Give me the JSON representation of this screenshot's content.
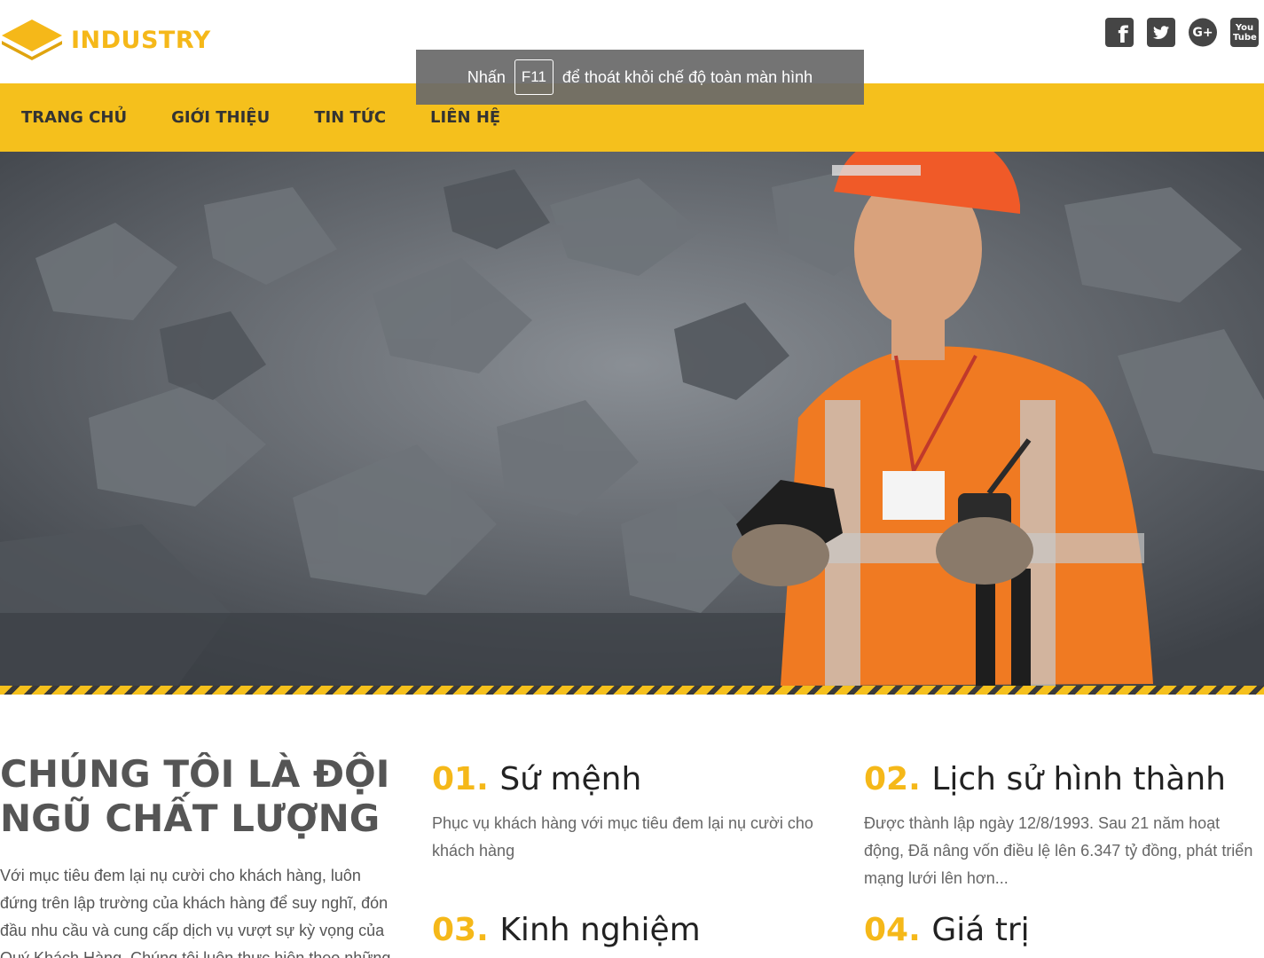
{
  "brand": {
    "name": "INDUSTRY",
    "accent": "#f5c01c"
  },
  "social": {
    "facebook_label": "f",
    "twitter_label": "t",
    "gplus_label": "G+",
    "youtube_label": "You Tube"
  },
  "nav": {
    "items": [
      {
        "label": "TRANG CHỦ"
      },
      {
        "label": "GIỚI THIỆU"
      },
      {
        "label": "TIN TỨC"
      },
      {
        "label": "LIÊN HỆ"
      }
    ]
  },
  "toast": {
    "prefix": "Nhấn",
    "key": "F11",
    "suffix": "để thoát khỏi chế độ toàn màn hình"
  },
  "intro": {
    "title": "CHÚNG TÔI LÀ ĐỘI NGŨ CHẤT LƯỢNG",
    "text": "Với mục tiêu đem lại nụ cười cho khách hàng, luôn đứng trên lập trường của khách hàng để suy nghĩ, đón đầu nhu cầu và cung cấp dịch vụ vượt sự kỳ vọng của Quý Khách Hàng. Chúng tôi luôn thực hiện theo những"
  },
  "features": [
    {
      "num": "01.",
      "title": "Sứ mệnh",
      "text": "Phục vụ khách hàng với mục tiêu đem lại nụ cười cho khách hàng"
    },
    {
      "num": "02.",
      "title": "Lịch sử hình thành",
      "text": "Được thành lập ngày 12/8/1993. Sau 21 năm hoạt động, Đã nâng vốn điều lệ lên 6.347 tỷ đồng, phát triển mạng lưới lên hơn..."
    },
    {
      "num": "03.",
      "title": "Kinh nghiệm",
      "text": ""
    },
    {
      "num": "04.",
      "title": "Giá trị",
      "text": ""
    }
  ]
}
